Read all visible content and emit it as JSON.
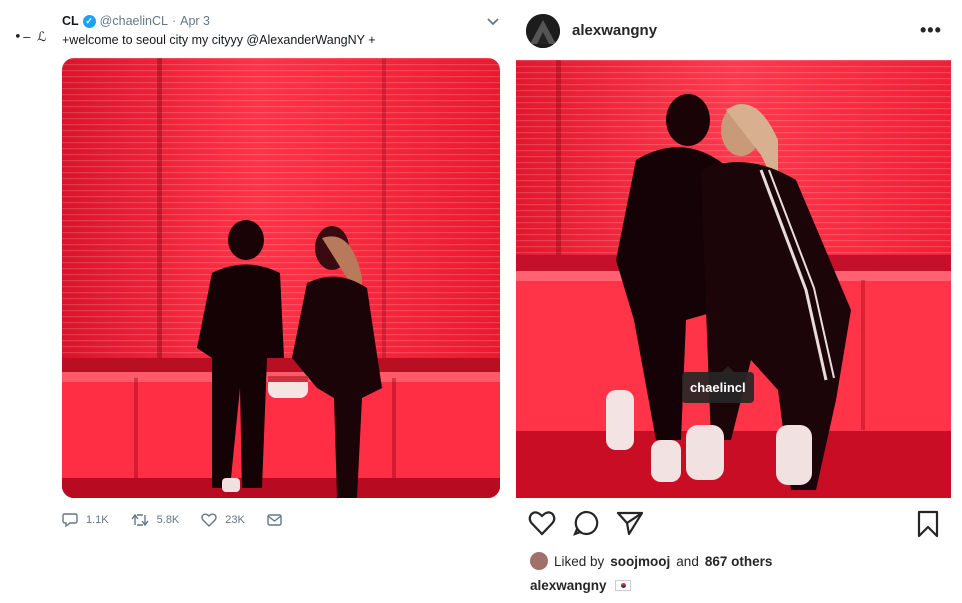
{
  "twitter": {
    "display_name": "CL",
    "handle": "@chaelinCL",
    "separator": "·",
    "date": "Apr 3",
    "text": "+welcome to seoul city my cityyy @AlexanderWangNY +",
    "avatar_text": "•‒ ℒ",
    "actions": {
      "replies": "1.1K",
      "retweets": "5.8K",
      "likes": "23K"
    },
    "icons": [
      "verified-badge-icon",
      "chevron-down-icon",
      "reply-icon",
      "retweet-icon",
      "heart-icon",
      "message-icon"
    ]
  },
  "instagram": {
    "username": "alexwangny",
    "more": "•••",
    "photo_tag": "chaelincl",
    "likes": {
      "prefix": "Liked by",
      "user": "soojmooj",
      "middle": "and",
      "others": "867 others"
    },
    "caption_user": "alexwangny",
    "icons": [
      "heart-icon",
      "comment-icon",
      "share-icon",
      "bookmark-icon",
      "tagged-user-icon",
      "korea-flag-icon"
    ]
  },
  "colors": {
    "photo_red": "#ff2438",
    "photo_dark_red": "#c8102a",
    "twitter_blue": "#1da1f2",
    "twitter_gray": "#657786",
    "instagram_text": "#262626"
  }
}
